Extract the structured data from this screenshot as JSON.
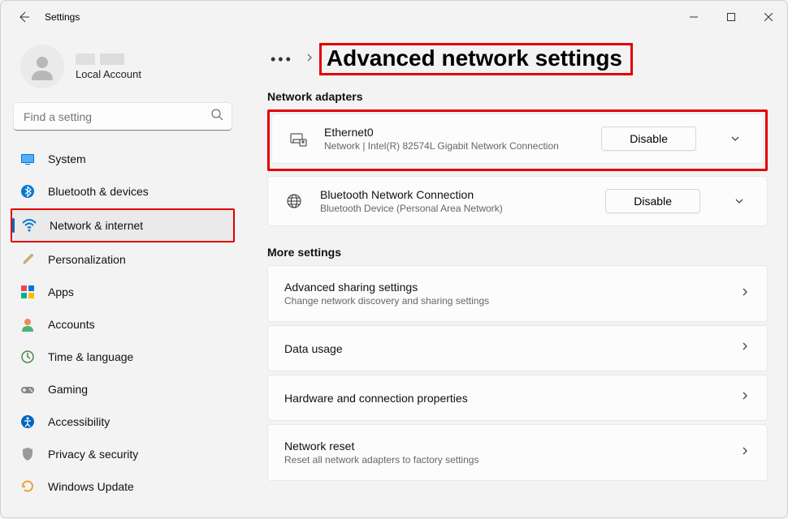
{
  "window": {
    "title": "Settings"
  },
  "profile": {
    "account_type": "Local Account"
  },
  "search": {
    "placeholder": "Find a setting"
  },
  "sidebar": {
    "items": [
      {
        "label": "System"
      },
      {
        "label": "Bluetooth & devices"
      },
      {
        "label": "Network & internet"
      },
      {
        "label": "Personalization"
      },
      {
        "label": "Apps"
      },
      {
        "label": "Accounts"
      },
      {
        "label": "Time & language"
      },
      {
        "label": "Gaming"
      },
      {
        "label": "Accessibility"
      },
      {
        "label": "Privacy & security"
      },
      {
        "label": "Windows Update"
      }
    ]
  },
  "breadcrumb": {
    "title": "Advanced network settings"
  },
  "sections": {
    "adapters_heading": "Network adapters",
    "more_heading": "More settings"
  },
  "adapters": [
    {
      "name": "Ethernet0",
      "desc": "Network | Intel(R) 82574L Gigabit Network Connection",
      "action": "Disable"
    },
    {
      "name": "Bluetooth Network Connection",
      "desc": "Bluetooth Device (Personal Area Network)",
      "action": "Disable"
    }
  ],
  "more_settings": [
    {
      "title": "Advanced sharing settings",
      "sub": "Change network discovery and sharing settings"
    },
    {
      "title": "Data usage",
      "sub": ""
    },
    {
      "title": "Hardware and connection properties",
      "sub": ""
    },
    {
      "title": "Network reset",
      "sub": "Reset all network adapters to factory settings"
    }
  ]
}
